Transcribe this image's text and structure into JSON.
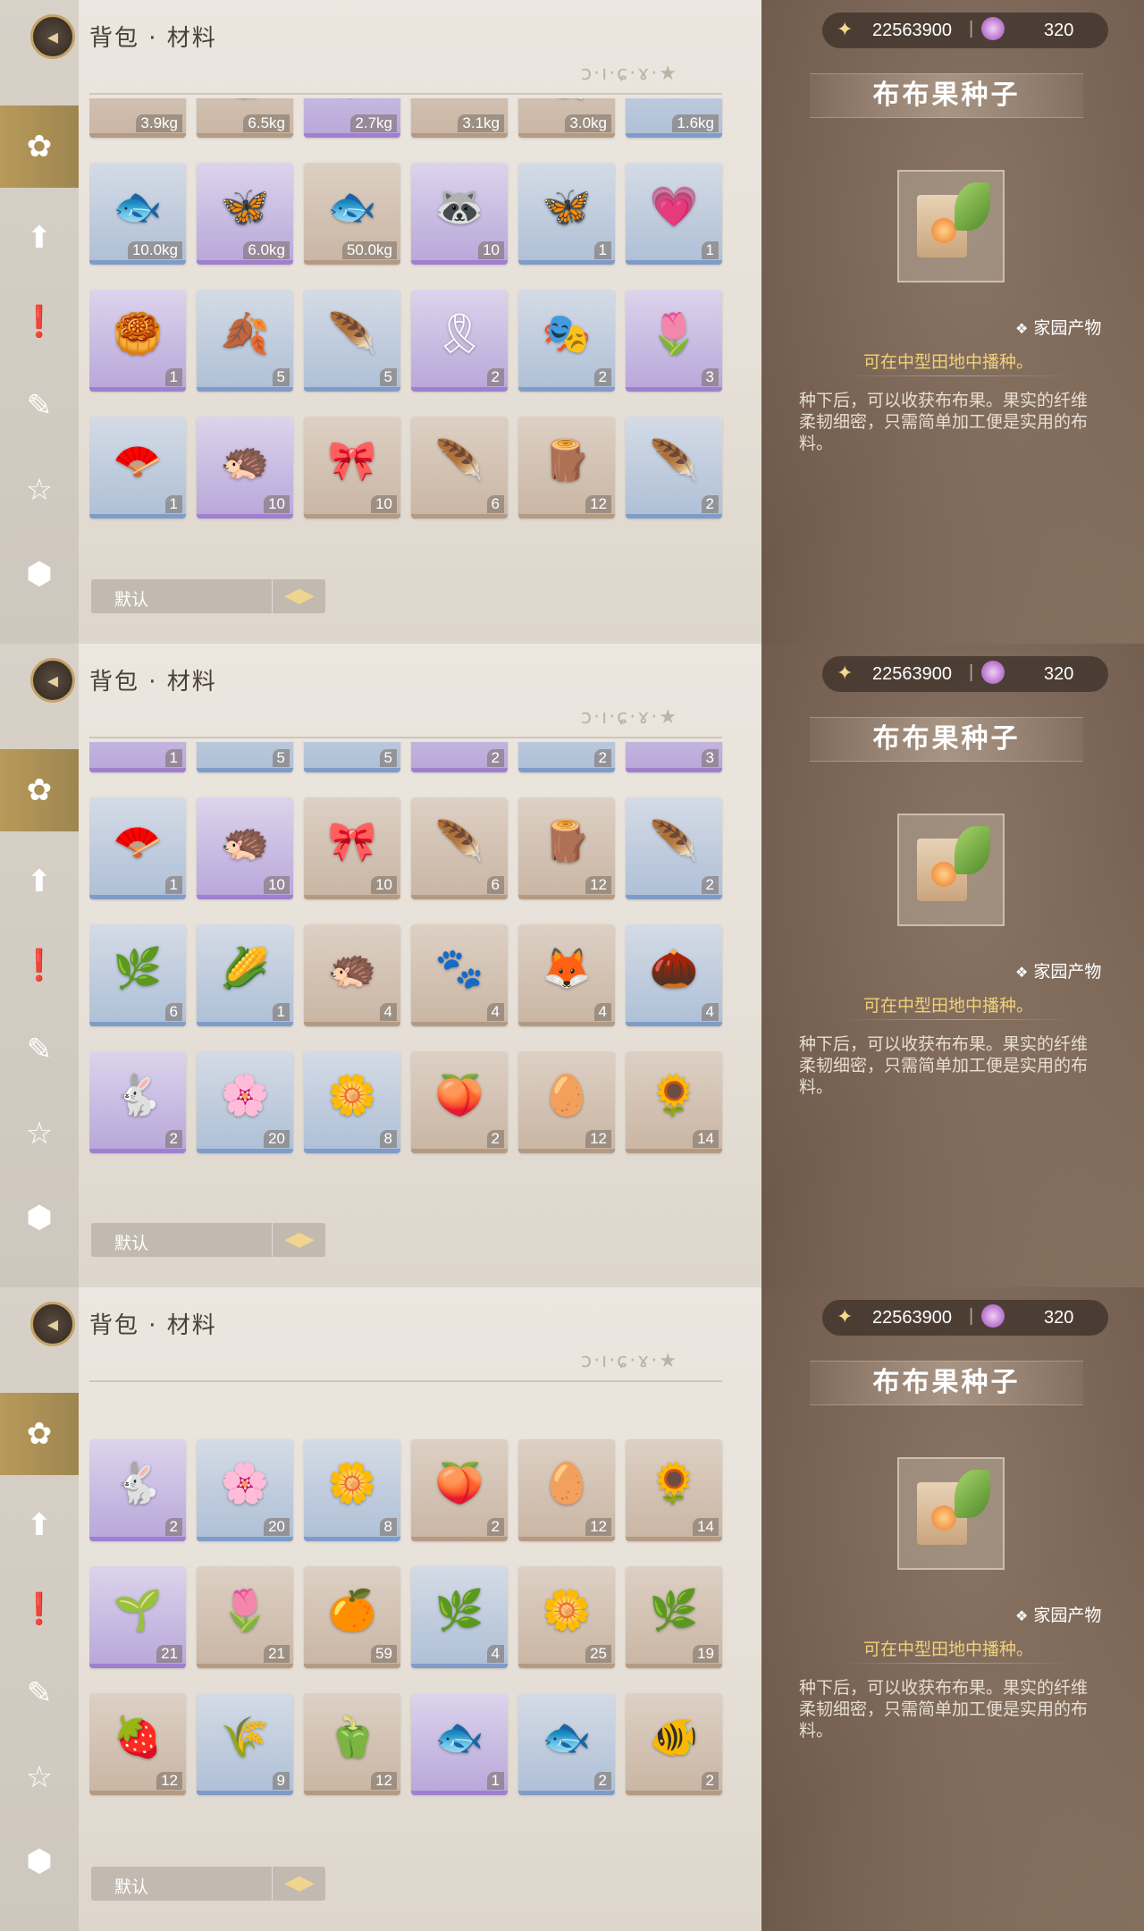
{
  "header": {
    "title": "背包 · 材料",
    "deco_text": "ɔ·ı·ɕ·ɤ·★"
  },
  "currency": {
    "coins": "22563900",
    "separator": "|",
    "gems": "320"
  },
  "item_detail": {
    "name": "布布果种子",
    "category": "家园产物",
    "plant_hint": "可在中型田地中播种。",
    "description": "种下后，可以收获布布果。果实的纤维柔韧细密，只需简单加工便是实用的布料。"
  },
  "sort": {
    "label": "默认"
  },
  "nav_icons": [
    "fish-icon",
    "upgrade-icon",
    "quest-icon",
    "feather-icon",
    "star-icon",
    "box-icon"
  ],
  "panels": [
    {
      "rows": [
        [
          "3.9kg",
          "6.5kg",
          "2.7kg",
          "3.1kg",
          "3.0kg",
          "1.6kg"
        ],
        [
          "10.0kg",
          "6.0kg",
          "50.0kg",
          "10",
          "1",
          "1"
        ],
        [
          "1",
          "5",
          "5",
          "2",
          "2",
          "3"
        ],
        [
          "1",
          "10",
          "10",
          "6",
          "12",
          "2"
        ]
      ],
      "colors": [
        [
          "tan",
          "tan",
          "purple",
          "tan",
          "tan",
          "blue"
        ],
        [
          "blue",
          "purple",
          "tan",
          "purple",
          "blue",
          "blue"
        ],
        [
          "purple",
          "blue",
          "blue",
          "purple",
          "blue",
          "purple"
        ],
        [
          "blue",
          "purple",
          "tan",
          "tan",
          "tan",
          "blue"
        ]
      ],
      "icons": [
        [
          "🐟",
          "🐠",
          "🐡",
          "🐟",
          "🐚",
          "🐟"
        ],
        [
          "🐟",
          "🦋",
          "🐟",
          "🦝",
          "🦋",
          "💗"
        ],
        [
          "🥮",
          "🍂",
          "🪶",
          "🎗",
          "🎭",
          "🌷"
        ],
        [
          "🪭",
          "🦔",
          "🎀",
          "🪶",
          "🪵",
          "🪶"
        ]
      ]
    },
    {
      "rows": [
        [
          "1",
          "5",
          "5",
          "2",
          "2",
          "3"
        ],
        [
          "1",
          "10",
          "10",
          "6",
          "12",
          "2"
        ],
        [
          "6",
          "1",
          "4",
          "4",
          "4",
          "4"
        ],
        [
          "2",
          "20",
          "8",
          "2",
          "12",
          "14"
        ]
      ],
      "colors": [
        [
          "purple",
          "blue",
          "blue",
          "purple",
          "blue",
          "purple"
        ],
        [
          "blue",
          "purple",
          "tan",
          "tan",
          "tan",
          "blue"
        ],
        [
          "blue",
          "blue",
          "tan",
          "tan",
          "tan",
          "blue"
        ],
        [
          "purple",
          "blue",
          "blue",
          "tan",
          "tan",
          "tan"
        ]
      ],
      "icons": [
        [
          "🥮",
          "🍂",
          "🪶",
          "🎗",
          "🎭",
          "🌷"
        ],
        [
          "🪭",
          "🦔",
          "🎀",
          "🪶",
          "🪵",
          "🪶"
        ],
        [
          "🌿",
          "🌽",
          "🦔",
          "🐾",
          "🦊",
          "🌰"
        ],
        [
          "🐇",
          "🌸",
          "🌼",
          "🍑",
          "🥚",
          "🌻"
        ]
      ]
    },
    {
      "rows": [
        [
          "2",
          "20",
          "8",
          "2",
          "12",
          "14"
        ],
        [
          "21",
          "21",
          "59",
          "4",
          "25",
          "19"
        ],
        [
          "12",
          "9",
          "12",
          "1",
          "2",
          "2"
        ]
      ],
      "colors": [
        [
          "purple",
          "blue",
          "blue",
          "tan",
          "tan",
          "tan"
        ],
        [
          "purple",
          "tan",
          "tan",
          "blue",
          "tan",
          "tan"
        ],
        [
          "tan",
          "blue",
          "tan",
          "purple",
          "blue",
          "tan"
        ]
      ],
      "icons": [
        [
          "🐇",
          "🌸",
          "🌼",
          "🍑",
          "🥚",
          "🌻"
        ],
        [
          "🌱",
          "🌷",
          "🍊",
          "🌿",
          "🌼",
          "🌿"
        ],
        [
          "🍓",
          "🌾",
          "🫑",
          "🐟",
          "🐟",
          "🐠"
        ]
      ]
    }
  ]
}
